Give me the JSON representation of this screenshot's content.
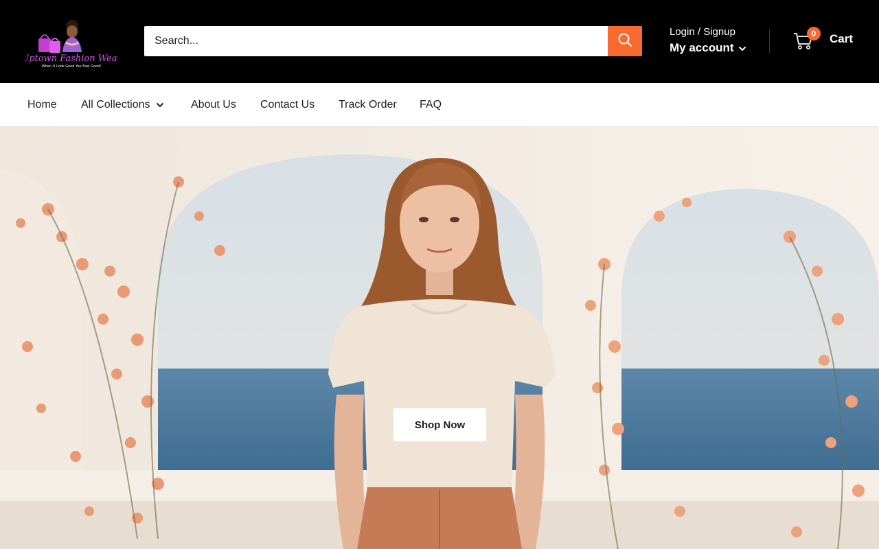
{
  "brand": {
    "name": "Uptown Fashion Wear",
    "tagline": "When U Look Good You Feel Good!"
  },
  "search": {
    "placeholder": "Search..."
  },
  "account": {
    "login_label": "Login / Signup",
    "my_account_label": "My account"
  },
  "cart": {
    "count": "0",
    "label": "Cart"
  },
  "nav": {
    "home": "Home",
    "collections": "All Collections",
    "about": "About Us",
    "contact": "Contact Us",
    "track": "Track Order",
    "faq": "FAQ"
  },
  "hero": {
    "cta_label": "Shop Now"
  },
  "colors": {
    "accent": "#f96a2e",
    "header_bg": "#000000",
    "text": "#1e1e1e"
  }
}
